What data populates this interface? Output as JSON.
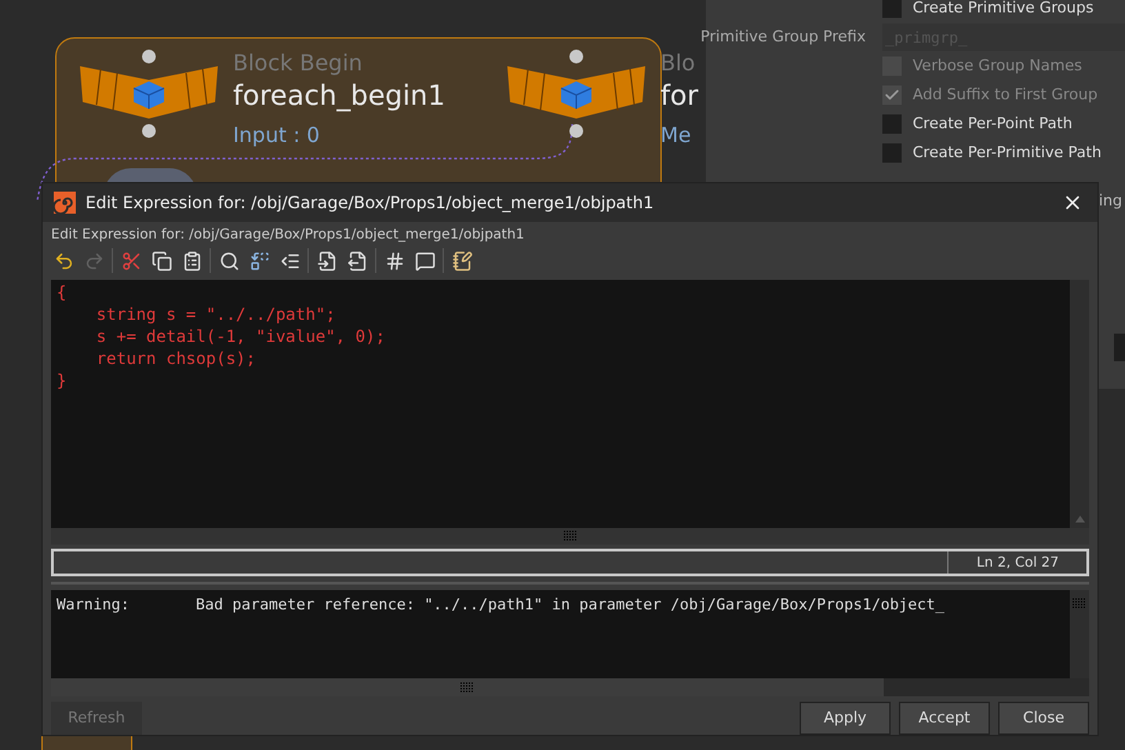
{
  "node_graph": {
    "nodes": [
      {
        "type_label": "Block Begin",
        "name": "foreach_begin1",
        "info": "Input : 0"
      },
      {
        "type_label": "Blo",
        "name": "for",
        "info": "Me"
      }
    ]
  },
  "parameters": {
    "rows": [
      {
        "kind": "checkbox",
        "label": "Create Primitive Groups",
        "checked": false,
        "disabled": false
      },
      {
        "kind": "field",
        "label": "Primitive Group Prefix",
        "value": "_primgrp_",
        "disabled": true
      },
      {
        "kind": "checkbox",
        "label": "Verbose Group Names",
        "checked": false,
        "disabled": true
      },
      {
        "kind": "checkbox",
        "label": "Add Suffix to First Group",
        "checked": true,
        "disabled": true
      },
      {
        "kind": "checkbox",
        "label": "Create Per-Point Path",
        "checked": false,
        "disabled": false
      },
      {
        "kind": "checkbox",
        "label": "Create Per-Primitive Path",
        "checked": false,
        "disabled": false
      }
    ],
    "side_text": "ing"
  },
  "dialog": {
    "title": "Edit Expression for: /obj/Garage/Box/Props1/object_merge1/objpath1",
    "subtitle": "Edit Expression for: /obj/Garage/Box/Props1/object_merge1/objpath1",
    "toolbar": [
      {
        "kind": "undo",
        "disabled": false,
        "separator_after": false
      },
      {
        "kind": "redo",
        "disabled": true,
        "separator_after": true
      },
      {
        "kind": "cut",
        "disabled": false,
        "separator_after": false
      },
      {
        "kind": "copy",
        "disabled": false,
        "separator_after": false
      },
      {
        "kind": "paste",
        "disabled": false,
        "separator_after": true
      },
      {
        "kind": "find",
        "disabled": false,
        "separator_after": false
      },
      {
        "kind": "replace",
        "disabled": false,
        "separator_after": false
      },
      {
        "kind": "goto",
        "disabled": false,
        "separator_after": true
      },
      {
        "kind": "import",
        "disabled": false,
        "separator_after": false
      },
      {
        "kind": "export",
        "disabled": false,
        "separator_after": true
      },
      {
        "kind": "comment",
        "disabled": false,
        "separator_after": false
      },
      {
        "kind": "uncomment",
        "disabled": false,
        "separator_after": true
      },
      {
        "kind": "notes",
        "disabled": false,
        "separator_after": false
      }
    ],
    "code": [
      "{",
      "    string s = \"../../path\";",
      "    s += detail(-1, \"ivalue\", 0);",
      "    return chsop(s);",
      "}"
    ],
    "status": "Ln 2, Col 27",
    "messages": [
      {
        "label": "Warning:",
        "text": "Bad parameter reference: \"../../path1\" in parameter /obj/Garage/Box/Props1/object_"
      }
    ],
    "buttons": [
      {
        "label": "Refresh",
        "disabled": true
      },
      {
        "label": "Apply",
        "disabled": false
      },
      {
        "label": "Accept",
        "disabled": false
      },
      {
        "label": "Close",
        "disabled": false
      }
    ]
  }
}
